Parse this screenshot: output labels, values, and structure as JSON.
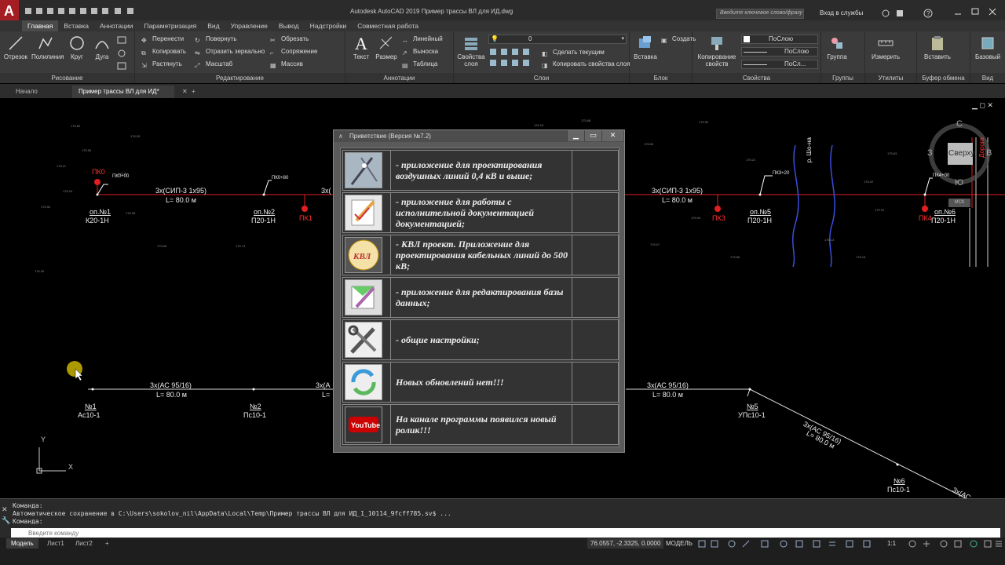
{
  "titlebar": {
    "app_title": "Autodesk AutoCAD 2019   Пример трассы ВЛ для ИД.dwg",
    "search_placeholder": "Введите ключевое слово/фразу",
    "signin": "Вход в службы"
  },
  "ribbon_tabs": [
    "Главная",
    "Вставка",
    "Аннотации",
    "Параметризация",
    "Вид",
    "Управление",
    "Вывод",
    "Надстройки",
    "Совместная работа"
  ],
  "ribbon": {
    "draw": {
      "title": "Рисование",
      "tools": [
        "Отрезок",
        "Полилиния",
        "Круг",
        "Дуга"
      ]
    },
    "modify": {
      "title": "Редактирование",
      "tools": [
        "Перенести",
        "Повернуть",
        "Обрезать",
        "Копировать",
        "Отразить зеркально",
        "Сопряжение",
        "Растянуть",
        "Масштаб",
        "Массив"
      ]
    },
    "annotation": {
      "title": "Аннотации",
      "tools": [
        "Текст",
        "Размер",
        "Линейный",
        "Выноска",
        "Таблица"
      ]
    },
    "layers": {
      "title": "Слои",
      "props": "Свойства слоя",
      "current_layer": "0",
      "make_current": "Сделать текущим",
      "match_layer": "Копировать свойства слоя"
    },
    "block": {
      "title": "Блок",
      "insert": "Вставка",
      "create": "Создать"
    },
    "properties": {
      "title": "Свойства",
      "match": "Копирование свойств",
      "bylayer1": "ПоСлою",
      "bylayer2": "ПоСлою",
      "bylayer3": "ПоСл..."
    },
    "groups": {
      "title": "Группы",
      "tool": "Группа"
    },
    "utilities": {
      "title": "Утилиты",
      "tool": "Измерить"
    },
    "clipboard": {
      "title": "Буфер обмена",
      "tool": "Вставить"
    },
    "view": {
      "title": "Вид",
      "tool": "Базовый"
    }
  },
  "doc_tabs": [
    "Начало",
    "Пример трассы ВЛ для ИД*"
  ],
  "drawing": {
    "viewcube": {
      "n": "С",
      "s": "Ю",
      "w": "З",
      "e": "В",
      "top": "Сверху",
      "ucs": "МСК"
    },
    "upper": {
      "pk0": "ПК0",
      "pk0_note": "ПК0+00",
      "pk1": "ПК1",
      "pk3": "ПК3",
      "pk4": "ПК4",
      "pk1_note": "ПК0+80",
      "pk3_note": "ПК3+20",
      "pk4_note": "ПК4+00",
      "span1": "3х(СИП-3 1х95)",
      "span1_len": "L= 80.0 м",
      "span2": "3х(",
      "span3": "3х(СИП-3 1х95)",
      "span3_len": "L= 80.0 м",
      "op1": "оп.№1",
      "op1_t": "К20-1Н",
      "op2": "оп.№2",
      "op2_t": "П20-1Н",
      "op5": "оп.№5",
      "op5_t": "П20-1Н",
      "op6": "оп.№6",
      "op6_t": "П20-1Н",
      "road": "Дорога",
      "vert_label": "р. Шо-на"
    },
    "lower": {
      "span1": "3х(АС 95/16)",
      "span1_len": "L= 80.0 м",
      "span2": "3х(А",
      "span2_len": "L=",
      "span3": "3х(АС 95/16)",
      "span3_len": "L= 80.0 м",
      "diag": "3х(АС 95/16)",
      "diag_len": "L= 80.0 м",
      "diag_end": "3х(АС",
      "n1": "№1",
      "n1_t": "Ас10-1",
      "n2": "№2",
      "n2_t": "Пс10-1",
      "n5": "№5",
      "n5_t": "УПс10-1",
      "n6": "№6",
      "n6_t": "Пс10-1"
    },
    "axes": {
      "y": "Y",
      "x": "X"
    }
  },
  "dialog": {
    "title": "Приветствие (Версия №7.2)",
    "rows": [
      {
        "icon": "power-line-icon",
        "text": "- приложение для проектирования воздушных линий 0,4 кВ и выше;"
      },
      {
        "icon": "document-pen-icon",
        "text": "- приложение для работы с исполнительной документацией документацией;"
      },
      {
        "icon": "kvl-logo-icon",
        "logo": "КВЛ",
        "text": "- КВЛ проект. Приложение для проектирования кабельных линий до 500 кВ;"
      },
      {
        "icon": "database-edit-icon",
        "text": "- приложение для редактирования базы данных;"
      },
      {
        "icon": "tools-icon",
        "text": "- общие настройки;"
      },
      {
        "icon": "refresh-icon",
        "text": "Новых обновлений нет!!!"
      },
      {
        "icon": "youtube-icon",
        "logo": "YouTube",
        "text": "На канале программы появился новый ролик!!!"
      }
    ]
  },
  "command": {
    "line1": "Команда:",
    "line2": "Автоматическое сохранение в C:\\Users\\sokolov_nil\\AppData\\Local\\Temp\\Пример трассы ВЛ для ИД_1_10114_9fcff785.sv$ ...",
    "line3": "Команда:",
    "placeholder": "Введите команду"
  },
  "status": {
    "layouts": [
      "Модель",
      "Лист1",
      "Лист2"
    ],
    "coords": "76.0557, -2.3325, 0.0000",
    "mode": "МОДЕЛЬ",
    "scale": "1:1"
  }
}
